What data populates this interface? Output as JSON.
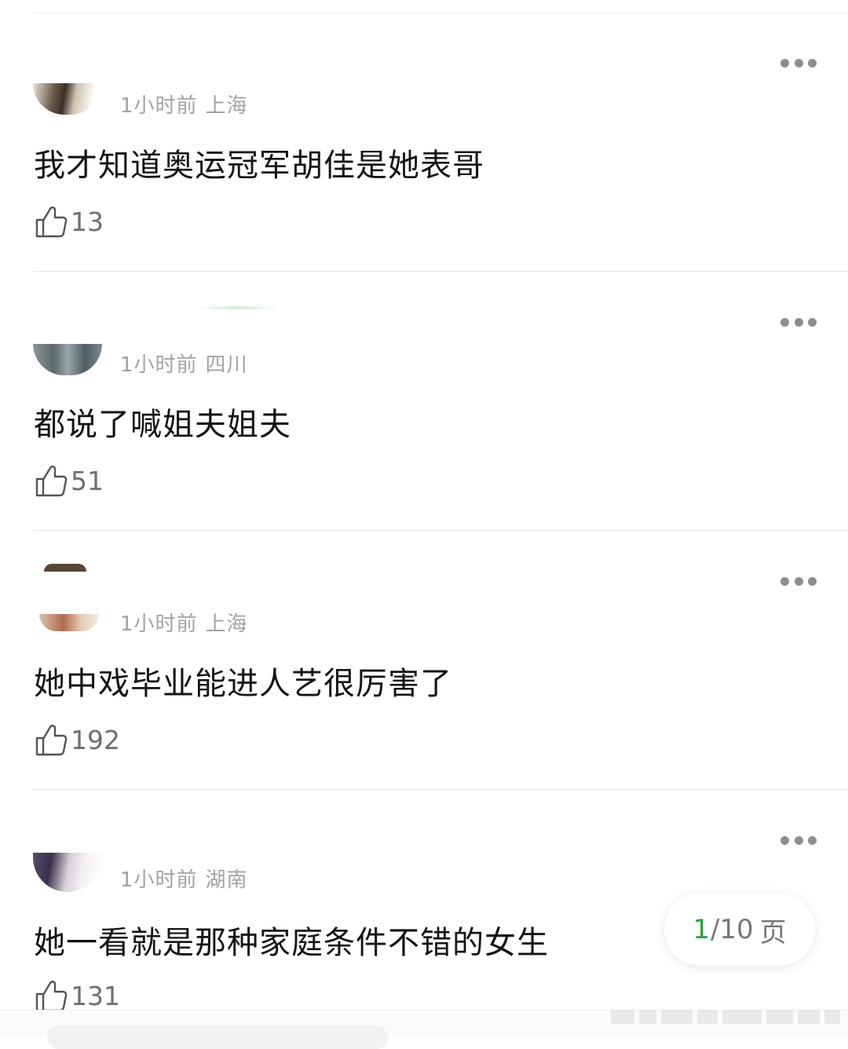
{
  "comments": [
    {
      "time": "1小时前",
      "location": "上海",
      "text": "我才知道奥运冠军胡佳是她表哥",
      "likes": "13"
    },
    {
      "time": "1小时前",
      "location": "四川",
      "text": "都说了喊姐夫姐夫",
      "likes": "51"
    },
    {
      "time": "1小时前",
      "location": "上海",
      "text": "她中戏毕业能进人艺很厉害了",
      "likes": "192"
    },
    {
      "time": "1小时前",
      "location": "湖南",
      "text": "她一看就是那种家庭条件不错的女生",
      "likes": "131"
    }
  ],
  "pager": {
    "current": "1",
    "total": "/10",
    "unit": "页"
  },
  "colors": {
    "accent": "#2aa43c",
    "meta": "#a3a3a3",
    "text": "#141414"
  },
  "icons": [
    "thumbs-up-icon",
    "more-icon"
  ]
}
